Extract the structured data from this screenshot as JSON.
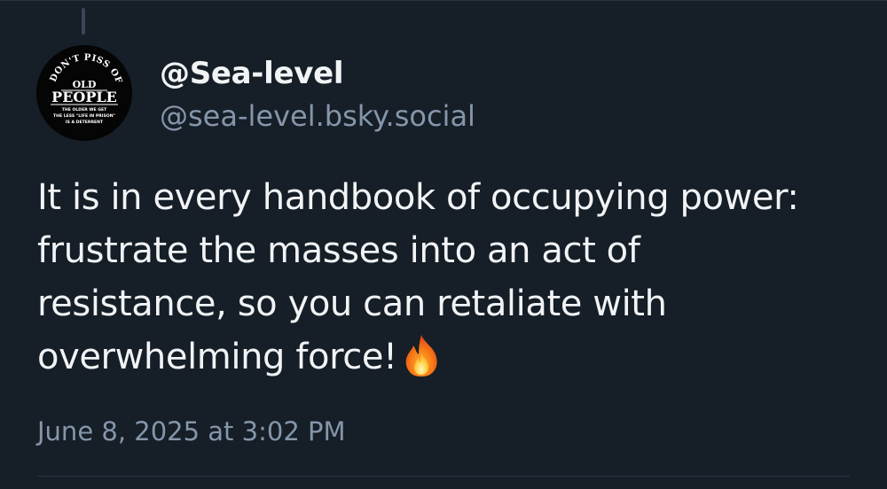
{
  "post": {
    "author": {
      "display_name": "@Sea-level",
      "handle": "@sea-level.bsky.social",
      "avatar": {
        "line1": "DON'T PISS OFF",
        "line2": "OLD",
        "line3": "PEOPLE",
        "line4": "THE OLDER WE GET",
        "line5": "THE LESS \"LIFE IN PRISON\"",
        "line6": "IS A DETERRENT"
      }
    },
    "text": "It is in every handbook of occupying power: frustrate the masses into an act of resistance, so you can retaliate with overwhelming force!",
    "emoji_icon": "fire-icon",
    "timestamp": "June 8, 2025 at 3:02 PM"
  },
  "colors": {
    "background": "#161e27",
    "primary_text": "#f1f3f5",
    "secondary_text": "#8596aa",
    "divider": "#2a3442"
  }
}
